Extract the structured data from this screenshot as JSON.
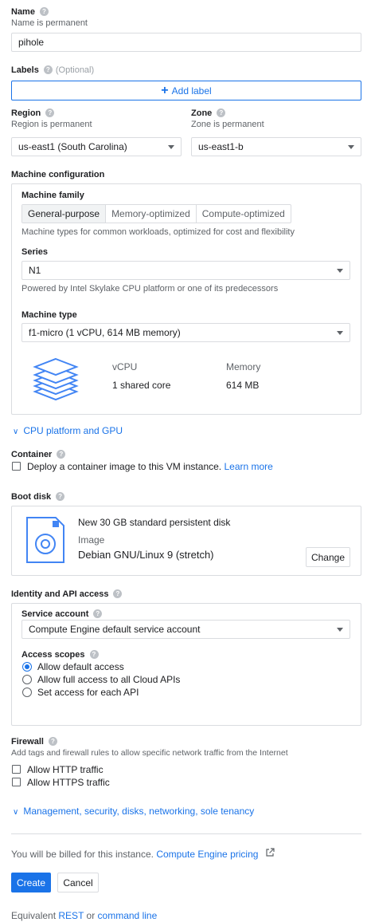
{
  "name": {
    "label": "Name",
    "hint": "Name is permanent",
    "value": "pihole"
  },
  "labels": {
    "label": "Labels",
    "optional": "(Optional)",
    "add_label": "Add label"
  },
  "region": {
    "label": "Region",
    "hint": "Region is permanent",
    "value": "us-east1 (South Carolina)"
  },
  "zone": {
    "label": "Zone",
    "hint": "Zone is permanent",
    "value": "us-east1-b"
  },
  "machine": {
    "section_title": "Machine configuration",
    "family_label": "Machine family",
    "family_tabs": [
      "General-purpose",
      "Memory-optimized",
      "Compute-optimized"
    ],
    "family_desc": "Machine types for common workloads, optimized for cost and flexibility",
    "series_label": "Series",
    "series_value": "N1",
    "series_desc": "Powered by Intel Skylake CPU platform or one of its predecessors",
    "type_label": "Machine type",
    "type_value": "f1-micro (1 vCPU, 614 MB memory)",
    "vcpu_header": "vCPU",
    "vcpu_value": "1 shared core",
    "memory_header": "Memory",
    "memory_value": "614 MB"
  },
  "cpu_platform_link": "CPU platform and GPU",
  "container": {
    "label": "Container",
    "checkbox_text": "Deploy a container image to this VM instance.",
    "learn_more": "Learn more"
  },
  "boot_disk": {
    "label": "Boot disk",
    "title": "New 30 GB standard persistent disk",
    "image_label": "Image",
    "image_value": "Debian GNU/Linux 9 (stretch)",
    "change_button": "Change"
  },
  "identity": {
    "label": "Identity and API access",
    "service_account_label": "Service account",
    "service_account_value": "Compute Engine default service account",
    "access_scopes_label": "Access scopes",
    "scopes": [
      "Allow default access",
      "Allow full access to all Cloud APIs",
      "Set access for each API"
    ],
    "selected_scope": "Allow default access"
  },
  "firewall": {
    "label": "Firewall",
    "desc": "Add tags and firewall rules to allow specific network traffic from the Internet",
    "http": "Allow HTTP traffic",
    "https": "Allow HTTPS traffic"
  },
  "management_link": "Management, security, disks, networking, sole tenancy",
  "billing": {
    "text": "You will be billed for this instance.",
    "link": "Compute Engine pricing"
  },
  "actions": {
    "create": "Create",
    "cancel": "Cancel"
  },
  "equivalent": {
    "prefix": "Equivalent",
    "rest": "REST",
    "or": "or",
    "command_line": "command line"
  },
  "colors": {
    "accent": "#1a73e8",
    "border": "#dadce0",
    "primary_button": "#1a73e8",
    "chip_blue": "#4285f4"
  }
}
